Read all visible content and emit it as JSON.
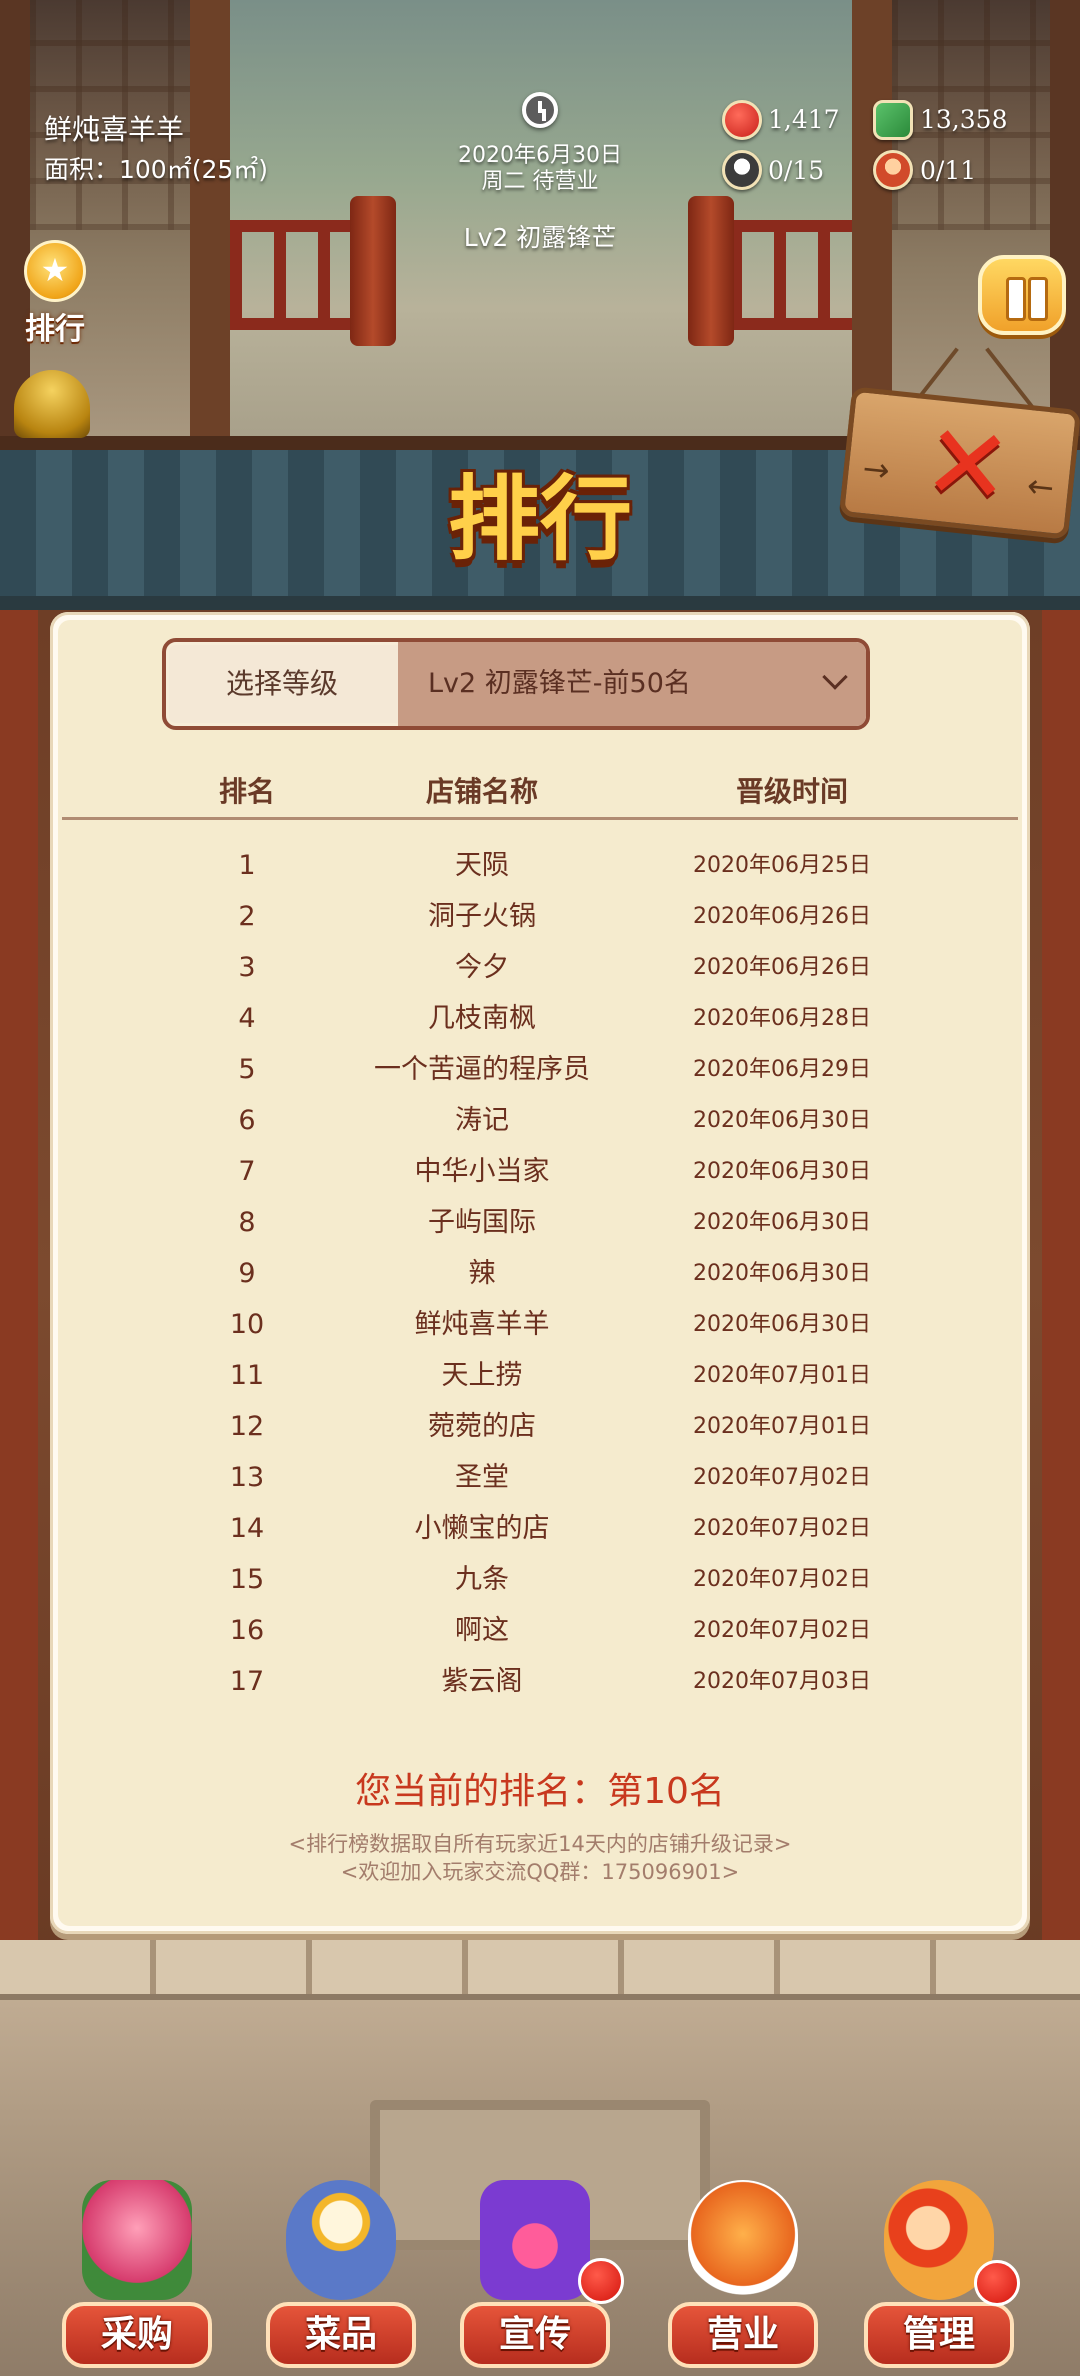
{
  "hud": {
    "shop_name": "鲜炖喜羊羊",
    "area": "面积：100㎡(25㎡)",
    "date": "2020年6月30日",
    "weekday_status": "周二 待营业",
    "level": "Lv2 初露锋芒",
    "stats": {
      "hearts": "1,417",
      "cash": "13,358",
      "chefs": "0/15",
      "staff": "0/11"
    },
    "rank_button": "排行"
  },
  "panel": {
    "title": "排行",
    "level_select": {
      "label": "选择等级",
      "value": "Lv2 初露锋芒-前50名"
    },
    "columns": [
      "排名",
      "店铺名称",
      "晋级时间"
    ],
    "rows": [
      {
        "rank": "1",
        "name": "天陨",
        "date": "2020年06月25日"
      },
      {
        "rank": "2",
        "name": "洞子火锅",
        "date": "2020年06月26日"
      },
      {
        "rank": "3",
        "name": "今夕",
        "date": "2020年06月26日"
      },
      {
        "rank": "4",
        "name": "几枝南枫",
        "date": "2020年06月28日"
      },
      {
        "rank": "5",
        "name": "一个苦逼的程序员",
        "date": "2020年06月29日"
      },
      {
        "rank": "6",
        "name": "涛记",
        "date": "2020年06月30日"
      },
      {
        "rank": "7",
        "name": "中华小当家",
        "date": "2020年06月30日"
      },
      {
        "rank": "8",
        "name": "子屿国际",
        "date": "2020年06月30日"
      },
      {
        "rank": "9",
        "name": "辣",
        "date": "2020年06月30日"
      },
      {
        "rank": "10",
        "name": "鲜炖喜羊羊",
        "date": "2020年06月30日"
      },
      {
        "rank": "11",
        "name": "天上捞",
        "date": "2020年07月01日"
      },
      {
        "rank": "12",
        "name": "菀菀的店",
        "date": "2020年07月01日"
      },
      {
        "rank": "13",
        "name": "圣堂",
        "date": "2020年07月02日"
      },
      {
        "rank": "14",
        "name": "小懒宝的店",
        "date": "2020年07月02日"
      },
      {
        "rank": "15",
        "name": "九条",
        "date": "2020年07月02日"
      },
      {
        "rank": "16",
        "name": "啊这",
        "date": "2020年07月02日"
      },
      {
        "rank": "17",
        "name": "紫云阁",
        "date": "2020年07月03日"
      }
    ],
    "my_rank": "您当前的排名：第10名",
    "note_1": "<排行榜数据取自所有玩家近14天内的店铺升级记录>",
    "note_2": "<欢迎加入玩家交流QQ群：175096901>"
  },
  "nav": {
    "items": [
      {
        "label": "采购",
        "icon": "shop-stall-icon"
      },
      {
        "label": "菜品",
        "icon": "dish-bowl-icon"
      },
      {
        "label": "宣传",
        "icon": "video-clapper-icon"
      },
      {
        "label": "营业",
        "icon": "serving-cloche-icon"
      },
      {
        "label": "管理",
        "icon": "staff-people-icon"
      }
    ]
  },
  "colors": {
    "accent_red": "#c8381e",
    "title_gold": "#ffd04a",
    "panel_bg": "#f5ebce"
  }
}
